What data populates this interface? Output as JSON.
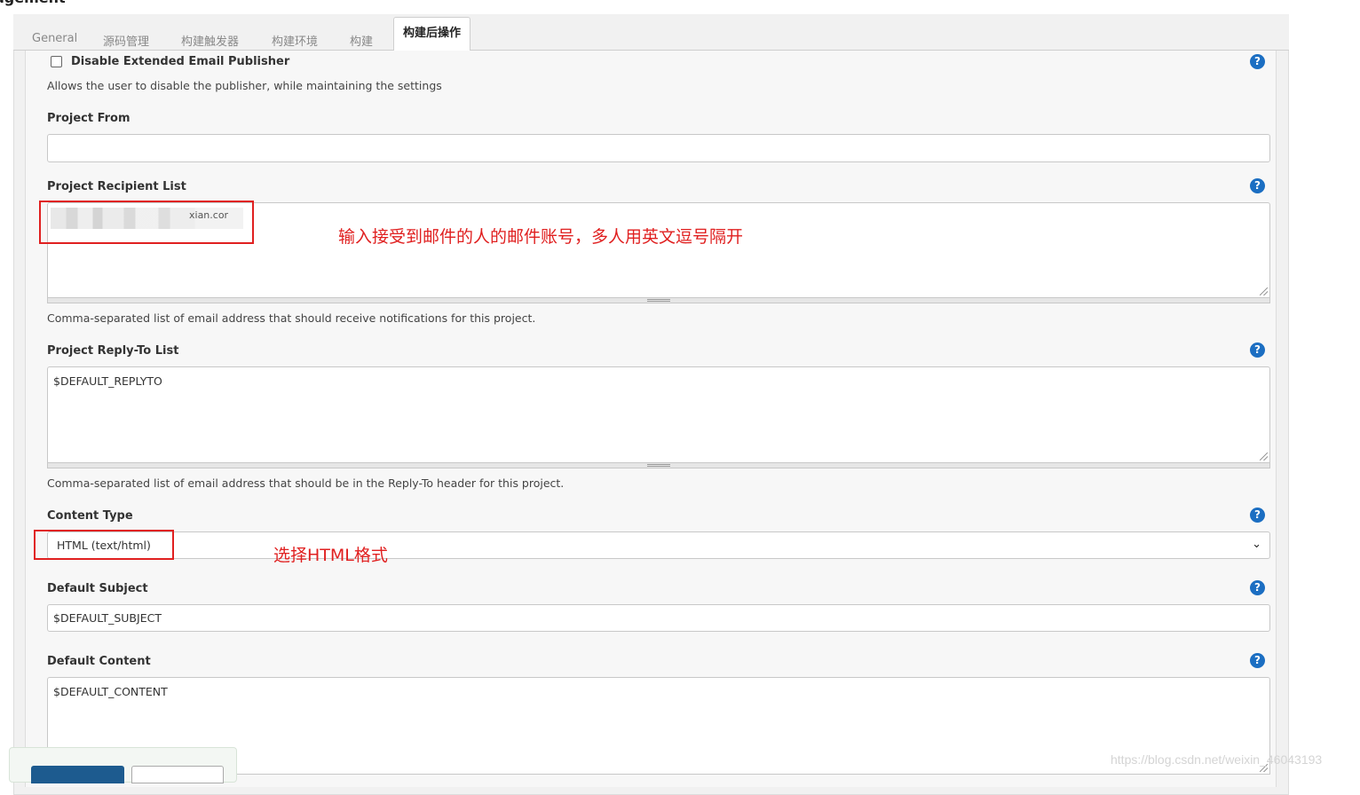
{
  "page": {
    "title_fragment": "agement"
  },
  "tabs": [
    {
      "label": "General",
      "active": false
    },
    {
      "label": "源码管理",
      "active": false
    },
    {
      "label": "构建触发器",
      "active": false
    },
    {
      "label": "构建环境",
      "active": false
    },
    {
      "label": "构建",
      "active": false
    },
    {
      "label": "构建后操作",
      "active": true
    }
  ],
  "help_symbol": "?",
  "form": {
    "disable_publisher": {
      "label": "Disable Extended Email Publisher",
      "checked": false,
      "description": "Allows the user to disable the publisher, while maintaining the settings"
    },
    "project_from": {
      "label": "Project From",
      "value": ""
    },
    "recipient_list": {
      "label": "Project Recipient List",
      "value_visible_fragment": "xian.cor",
      "description": "Comma-separated list of email address that should receive notifications for this project."
    },
    "reply_to_list": {
      "label": "Project Reply-To List",
      "value": "$DEFAULT_REPLYTO",
      "description": "Comma-separated list of email address that should be in the Reply-To header for this project."
    },
    "content_type": {
      "label": "Content Type",
      "selected": "HTML (text/html)"
    },
    "default_subject": {
      "label": "Default Subject",
      "value": "$DEFAULT_SUBJECT"
    },
    "default_content": {
      "label": "Default Content",
      "value": "$DEFAULT_CONTENT"
    }
  },
  "annotations": {
    "recipient_note": "输入接受到邮件的人的邮件账号，多人用英文逗号隔开",
    "content_type_note": "选择HTML格式",
    "color": "#e02020"
  },
  "watermark": "https://blog.csdn.net/weixin_46043193"
}
